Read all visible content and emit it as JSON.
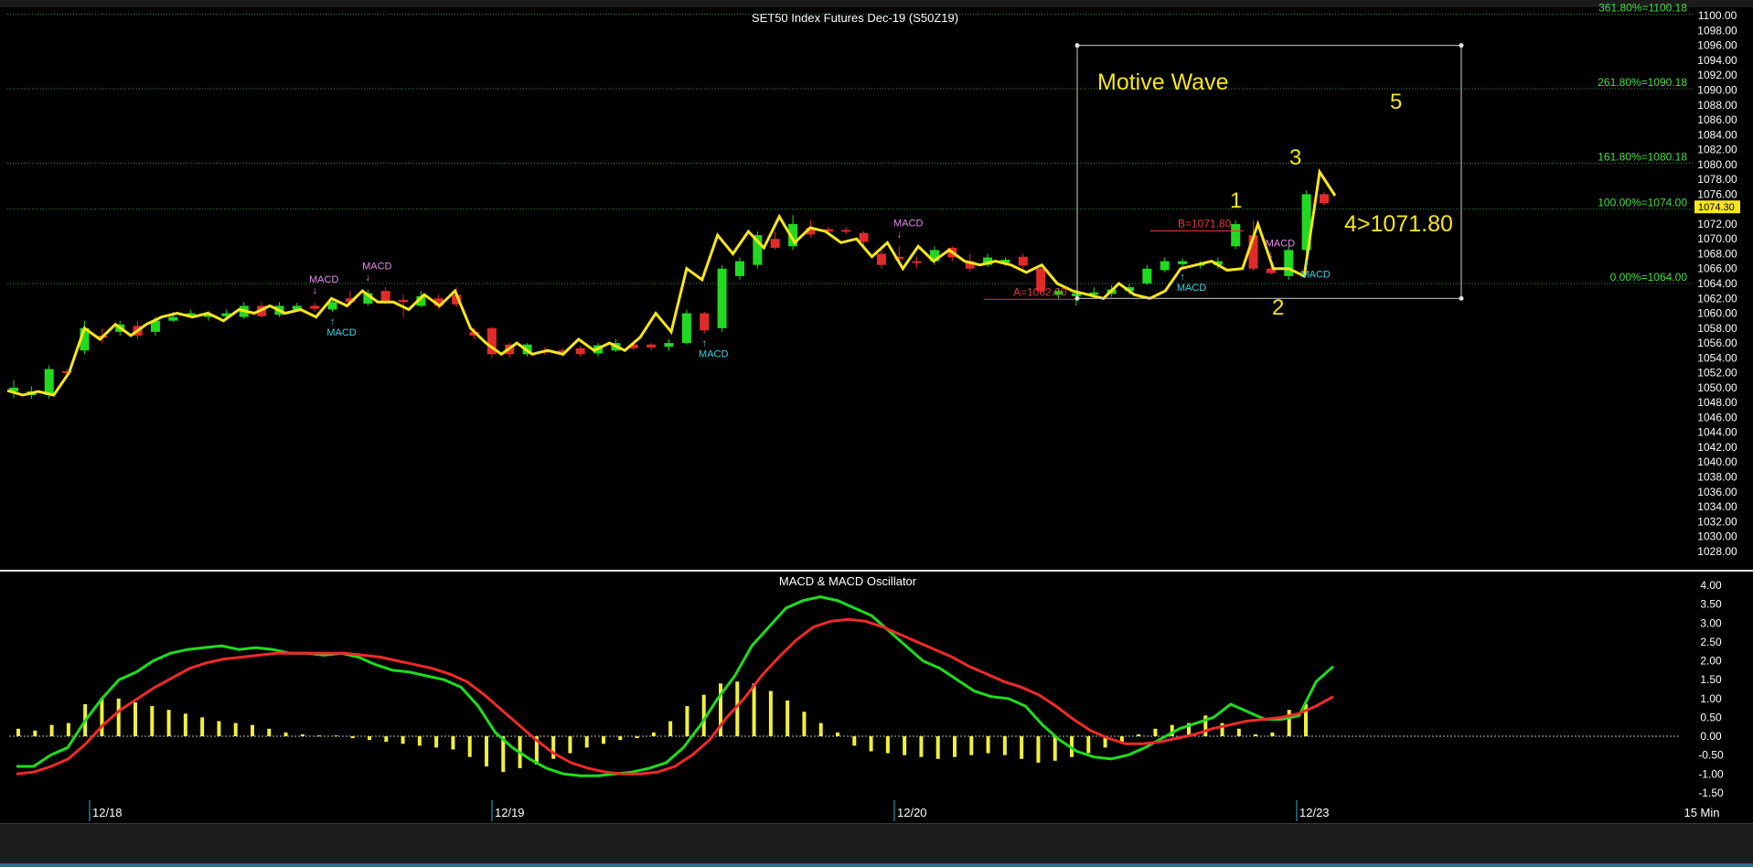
{
  "chart_data": [
    {
      "type": "candlestick",
      "title": "SET50 Index Futures Dec-19 (S50Z19)",
      "ylim": [
        1027,
        1101
      ],
      "y_ticks": [
        1028,
        1030,
        1032,
        1034,
        1036,
        1038,
        1040,
        1042,
        1044,
        1046,
        1048,
        1050,
        1052,
        1054,
        1056,
        1058,
        1060,
        1062,
        1064,
        1066,
        1068,
        1070,
        1072,
        1074,
        1076,
        1078,
        1080,
        1082,
        1084,
        1086,
        1088,
        1090,
        1092,
        1094,
        1096,
        1098,
        1100
      ],
      "current_price": "1074.30",
      "fib_levels": [
        {
          "label": "361.80%=1100.18",
          "value": 1100.18
        },
        {
          "label": "261.80%=1090.18",
          "value": 1090.18
        },
        {
          "label": "161.80%=1080.18",
          "value": 1080.18
        },
        {
          "label": "100.00%=1074.00",
          "value": 1074.0
        },
        {
          "label": "0.00%=1064.00",
          "value": 1064.0
        }
      ],
      "bar_close_line": [
        1049.6,
        1049,
        1049.5,
        1049,
        1052,
        1058,
        1056.5,
        1058.5,
        1057,
        1058.5,
        1059.5,
        1060,
        1059.5,
        1060,
        1059,
        1060.5,
        1060,
        1061,
        1060,
        1060.5,
        1059.5,
        1062,
        1061,
        1063,
        1061.5,
        1061.5,
        1060.5,
        1062.5,
        1061,
        1063,
        1058,
        1056,
        1054.5,
        1056,
        1054.5,
        1055,
        1054.5,
        1056.5,
        1055,
        1056,
        1055,
        1056.8,
        1060,
        1057.5,
        1066,
        1064.5,
        1070.5,
        1068,
        1071,
        1068.8,
        1073,
        1069.5,
        1071.5,
        1071,
        1069.5,
        1070,
        1067.6,
        1069.5,
        1066,
        1069,
        1067,
        1068.5,
        1067,
        1066.5,
        1067,
        1066.5,
        1065.5,
        1066.5,
        1064,
        1063,
        1062.5,
        1062,
        1064,
        1062.5,
        1062,
        1063,
        1066,
        1066.5,
        1067,
        1065.8,
        1066,
        1072,
        1066,
        1066,
        1065,
        1079,
        1075.8
      ],
      "candles": [
        {
          "o": 1049.5,
          "c": 1050,
          "h": 1051,
          "l": 1048.6
        },
        {
          "o": 1049,
          "c": 1049.5,
          "h": 1050.2,
          "l": 1048.5
        },
        {
          "o": 1049,
          "c": 1052.5,
          "h": 1053,
          "l": 1048.5
        },
        {
          "o": 1052.2,
          "c": 1052,
          "h": 1052.6,
          "l": 1051.8
        },
        {
          "o": 1055,
          "c": 1058,
          "h": 1059,
          "l": 1054.5
        },
        {
          "o": 1057,
          "c": 1056.7,
          "h": 1058,
          "l": 1056
        },
        {
          "o": 1057.5,
          "c": 1058.5,
          "h": 1059,
          "l": 1057
        },
        {
          "o": 1058.3,
          "c": 1057,
          "h": 1059,
          "l": 1056.5
        },
        {
          "o": 1057.5,
          "c": 1059,
          "h": 1059.5,
          "l": 1057
        },
        {
          "o": 1059,
          "c": 1059.5,
          "h": 1060.2,
          "l": 1058.8
        },
        {
          "o": 1059.8,
          "c": 1060,
          "h": 1060.5,
          "l": 1059.4
        },
        {
          "o": 1059.5,
          "c": 1059.8,
          "h": 1060.3,
          "l": 1059
        },
        {
          "o": 1059.6,
          "c": 1060,
          "h": 1060.5,
          "l": 1059.3
        },
        {
          "o": 1059.5,
          "c": 1061,
          "h": 1061.5,
          "l": 1059.2
        },
        {
          "o": 1061,
          "c": 1059.6,
          "h": 1061.5,
          "l": 1059.4
        },
        {
          "o": 1059.8,
          "c": 1061,
          "h": 1061.5,
          "l": 1059.5
        },
        {
          "o": 1060.5,
          "c": 1061,
          "h": 1061.4,
          "l": 1060.2
        },
        {
          "o": 1061,
          "c": 1060.6,
          "h": 1061.4,
          "l": 1060.2
        },
        {
          "o": 1060.5,
          "c": 1061.5,
          "h": 1062,
          "l": 1060.2
        },
        {
          "o": 1062,
          "c": 1061.5,
          "h": 1063,
          "l": 1061
        },
        {
          "o": 1061.3,
          "c": 1062.7,
          "h": 1063.2,
          "l": 1061
        },
        {
          "o": 1063,
          "c": 1061.5,
          "h": 1063.5,
          "l": 1061.2
        },
        {
          "o": 1061.8,
          "c": 1061.5,
          "h": 1062.5,
          "l": 1059.5
        },
        {
          "o": 1061,
          "c": 1062.3,
          "h": 1063,
          "l": 1060.8
        },
        {
          "o": 1062,
          "c": 1061,
          "h": 1062.5,
          "l": 1060.5
        },
        {
          "o": 1062.5,
          "c": 1061.2,
          "h": 1063.5,
          "l": 1060.8
        },
        {
          "o": 1057.5,
          "c": 1057,
          "h": 1058,
          "l": 1056.5
        },
        {
          "o": 1058,
          "c": 1054.5,
          "h": 1058.2,
          "l": 1054
        },
        {
          "o": 1055.8,
          "c": 1054.5,
          "h": 1056,
          "l": 1054
        },
        {
          "o": 1054.5,
          "c": 1055.8,
          "h": 1056,
          "l": 1054.2
        },
        {
          "o": 1055,
          "c": 1054.7,
          "h": 1055.5,
          "l": 1054.4
        },
        {
          "o": 1055,
          "c": 1054.8,
          "h": 1055.3,
          "l": 1054.5
        },
        {
          "o": 1055.3,
          "c": 1054.5,
          "h": 1055.6,
          "l": 1054.2
        },
        {
          "o": 1054.6,
          "c": 1055.7,
          "h": 1056,
          "l": 1054.2
        },
        {
          "o": 1055,
          "c": 1056,
          "h": 1056.5,
          "l": 1054.8
        },
        {
          "o": 1055.8,
          "c": 1055.3,
          "h": 1056.2,
          "l": 1055
        },
        {
          "o": 1055.8,
          "c": 1055.4,
          "h": 1056,
          "l": 1055
        },
        {
          "o": 1055.5,
          "c": 1056,
          "h": 1056.5,
          "l": 1055
        },
        {
          "o": 1056,
          "c": 1060,
          "h": 1060.5,
          "l": 1055.8
        },
        {
          "o": 1060,
          "c": 1057.7,
          "h": 1060.2,
          "l": 1057.3
        },
        {
          "o": 1058,
          "c": 1066,
          "h": 1066.5,
          "l": 1057.5
        },
        {
          "o": 1065,
          "c": 1067,
          "h": 1067.5,
          "l": 1064.5
        },
        {
          "o": 1066.5,
          "c": 1070.5,
          "h": 1071,
          "l": 1066
        },
        {
          "o": 1070,
          "c": 1068.8,
          "h": 1071,
          "l": 1068.5
        },
        {
          "o": 1069,
          "c": 1072,
          "h": 1073.2,
          "l": 1068.5
        },
        {
          "o": 1071.5,
          "c": 1070.6,
          "h": 1072.5,
          "l": 1070.2
        },
        {
          "o": 1071.3,
          "c": 1071,
          "h": 1071.6,
          "l": 1070.8
        },
        {
          "o": 1071.2,
          "c": 1071,
          "h": 1071.6,
          "l": 1070.6
        },
        {
          "o": 1070.8,
          "c": 1069.6,
          "h": 1071,
          "l": 1069.2
        },
        {
          "o": 1068,
          "c": 1066.5,
          "h": 1068.5,
          "l": 1066
        },
        {
          "o": 1067.6,
          "c": 1067.3,
          "h": 1069,
          "l": 1067
        },
        {
          "o": 1067,
          "c": 1066.8,
          "h": 1067.6,
          "l": 1066
        },
        {
          "o": 1067,
          "c": 1068.5,
          "h": 1069,
          "l": 1066.5
        },
        {
          "o": 1068.8,
          "c": 1067.5,
          "h": 1069,
          "l": 1067
        },
        {
          "o": 1067,
          "c": 1066,
          "h": 1068,
          "l": 1065.6
        },
        {
          "o": 1066.5,
          "c": 1067.5,
          "h": 1068,
          "l": 1066.2
        },
        {
          "o": 1066.8,
          "c": 1067.2,
          "h": 1067.5,
          "l": 1066.4
        },
        {
          "o": 1067.6,
          "c": 1066.4,
          "h": 1068,
          "l": 1066
        },
        {
          "o": 1066,
          "c": 1063,
          "h": 1066.5,
          "l": 1062.5
        },
        {
          "o": 1062.5,
          "c": 1063,
          "h": 1063.4,
          "l": 1062
        },
        {
          "o": 1062.3,
          "c": 1062.7,
          "h": 1063,
          "l": 1061
        },
        {
          "o": 1062.5,
          "c": 1062.8,
          "h": 1063.5,
          "l": 1062
        },
        {
          "o": 1062.6,
          "c": 1063.2,
          "h": 1063.8,
          "l": 1062.2
        },
        {
          "o": 1063,
          "c": 1063.5,
          "h": 1064,
          "l": 1062.5
        },
        {
          "o": 1064,
          "c": 1066,
          "h": 1066.5,
          "l": 1063.8
        },
        {
          "o": 1065.8,
          "c": 1067,
          "h": 1067.5,
          "l": 1065.5
        },
        {
          "o": 1066.6,
          "c": 1067,
          "h": 1067.4,
          "l": 1066.2
        },
        {
          "o": 1066.4,
          "c": 1066.7,
          "h": 1067,
          "l": 1066
        },
        {
          "o": 1066.5,
          "c": 1067,
          "h": 1067.5,
          "l": 1066
        },
        {
          "o": 1069,
          "c": 1072,
          "h": 1072.5,
          "l": 1068.6
        },
        {
          "o": 1070.5,
          "c": 1066,
          "h": 1072.5,
          "l": 1065.7
        },
        {
          "o": 1066,
          "c": 1065.4,
          "h": 1066.3,
          "l": 1065.2
        },
        {
          "o": 1065,
          "c": 1068.5,
          "h": 1069,
          "l": 1064.5
        },
        {
          "o": 1068.5,
          "c": 1076,
          "h": 1076.5,
          "l": 1068
        },
        {
          "o": 1076,
          "c": 1074.8,
          "h": 1076.3,
          "l": 1074.5
        }
      ],
      "signals_up": [
        {
          "label": "MACD",
          "at": 18
        },
        {
          "label": "MACD",
          "at": 39
        },
        {
          "label": "MACD",
          "at": 66
        },
        {
          "label": "MACD",
          "at": 73
        }
      ],
      "signals_down": [
        {
          "label": "MACD",
          "at": 17
        },
        {
          "label": "MACD",
          "at": 20
        },
        {
          "label": "MACD",
          "at": 50
        },
        {
          "label": "MACD",
          "at": 71
        }
      ],
      "annotations": {
        "box_label": "Motive Wave",
        "wave_1": "1",
        "wave_2": "2",
        "wave_3": "3",
        "wave_4": "4>1071.80",
        "wave_5": "5",
        "a_label": "A=1062.00",
        "a_value": 1062.0,
        "b_label": "B=1071.80",
        "b_value": 1071.8,
        "box_top": 1096,
        "box_bottom": 1062
      }
    },
    {
      "type": "line",
      "title": "MACD & MACD Oscillator",
      "ylim": [
        -1.6,
        4.1
      ],
      "y_ticks": [
        "4.00",
        "3.50",
        "3.00",
        "2.50",
        "2.00",
        "1.50",
        "1.00",
        "0.50",
        "0.00",
        "-0.50",
        "-1.00",
        "-1.50"
      ],
      "x_date_labels": [
        "12/18",
        "12/19",
        "12/20",
        "12/23"
      ],
      "interval_label": "15 Min",
      "series": [
        {
          "color": "#1edc1e",
          "values": [
            -0.8,
            -0.8,
            -0.5,
            -0.3,
            0.4,
            1.0,
            1.5,
            1.7,
            2.0,
            2.2,
            2.3,
            2.35,
            2.4,
            2.3,
            2.35,
            2.3,
            2.2,
            2.2,
            2.15,
            2.2,
            2.1,
            1.9,
            1.75,
            1.7,
            1.6,
            1.5,
            1.3,
            0.8,
            0.1,
            -0.3,
            -0.6,
            -0.85,
            -1.0,
            -1.05,
            -1.05,
            -1.0,
            -0.95,
            -0.85,
            -0.7,
            -0.3,
            0.3,
            1.0,
            1.6,
            2.4,
            2.9,
            3.4,
            3.6,
            3.7,
            3.6,
            3.4,
            3.2,
            2.8,
            2.4,
            2.0,
            1.8,
            1.5,
            1.2,
            1.05,
            1.0,
            0.8,
            0.3,
            -0.1,
            -0.4,
            -0.55,
            -0.6,
            -0.5,
            -0.3,
            -0.05,
            0.2,
            0.35,
            0.5,
            0.85,
            0.65,
            0.45,
            0.45,
            0.55,
            1.45,
            1.85
          ]
        },
        {
          "color": "#ee2a2a",
          "values": [
            -1.0,
            -0.95,
            -0.8,
            -0.6,
            -0.2,
            0.3,
            0.7,
            1.0,
            1.3,
            1.55,
            1.8,
            1.95,
            2.05,
            2.1,
            2.15,
            2.2,
            2.2,
            2.2,
            2.2,
            2.2,
            2.15,
            2.1,
            2.0,
            1.9,
            1.8,
            1.65,
            1.45,
            1.1,
            0.7,
            0.3,
            -0.1,
            -0.45,
            -0.7,
            -0.85,
            -0.95,
            -1.0,
            -1.0,
            -0.95,
            -0.8,
            -0.5,
            -0.1,
            0.5,
            1.0,
            1.6,
            2.1,
            2.55,
            2.9,
            3.05,
            3.1,
            3.05,
            2.9,
            2.7,
            2.5,
            2.3,
            2.1,
            1.85,
            1.65,
            1.45,
            1.3,
            1.1,
            0.8,
            0.45,
            0.15,
            -0.05,
            -0.2,
            -0.2,
            -0.15,
            -0.05,
            0.05,
            0.2,
            0.3,
            0.4,
            0.45,
            0.5,
            0.6,
            0.8,
            1.05
          ]
        },
        {
          "type": "bar",
          "color": "#f0f03c",
          "values": [
            0.2,
            0.15,
            0.3,
            0.35,
            0.85,
            1.0,
            1.0,
            0.9,
            0.8,
            0.7,
            0.6,
            0.5,
            0.4,
            0.35,
            0.3,
            0.2,
            0.1,
            0.05,
            0.02,
            0.02,
            -0.05,
            -0.1,
            -0.15,
            -0.2,
            -0.25,
            -0.3,
            -0.35,
            -0.55,
            -0.8,
            -0.95,
            -0.85,
            -0.75,
            -0.6,
            -0.45,
            -0.3,
            -0.2,
            -0.1,
            -0.05,
            0.1,
            0.4,
            0.8,
            1.1,
            1.4,
            1.45,
            1.4,
            1.2,
            0.95,
            0.65,
            0.35,
            0.1,
            -0.25,
            -0.4,
            -0.45,
            -0.5,
            -0.55,
            -0.6,
            -0.55,
            -0.5,
            -0.45,
            -0.5,
            -0.6,
            -0.7,
            -0.65,
            -0.55,
            -0.45,
            -0.3,
            -0.15,
            0.05,
            0.2,
            0.3,
            0.35,
            0.55,
            0.35,
            0.2,
            0.05,
            0.1,
            0.7,
            0.85
          ]
        }
      ]
    }
  ]
}
